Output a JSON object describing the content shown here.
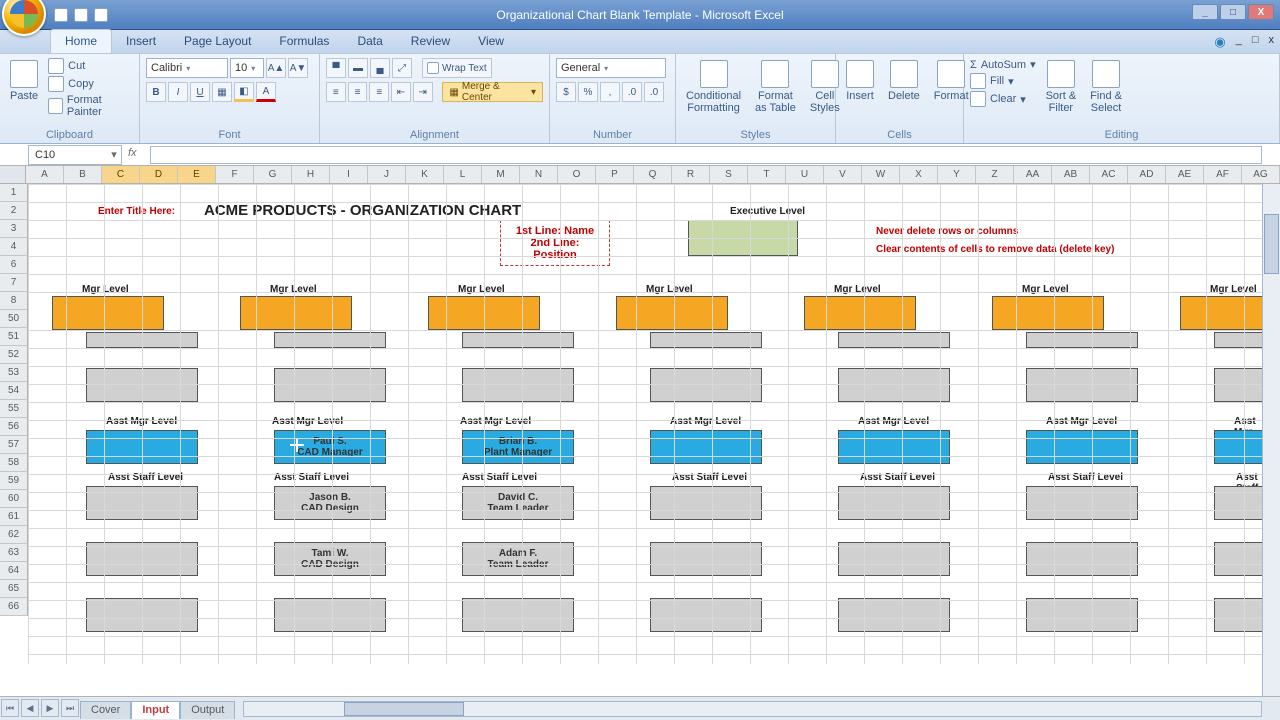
{
  "window": {
    "title": "Organizational Chart Blank Template - Microsoft Excel",
    "btn_min": "_",
    "btn_max": "□",
    "btn_close": "X"
  },
  "tabs": {
    "home": "Home",
    "insert": "Insert",
    "pagelayout": "Page Layout",
    "formulas": "Formulas",
    "data": "Data",
    "review": "Review",
    "view": "View"
  },
  "ribbon": {
    "clipboard": {
      "paste": "Paste",
      "cut": "Cut",
      "copy": "Copy",
      "fmtpainter": "Format Painter",
      "label": "Clipboard"
    },
    "font": {
      "family": "Calibri",
      "size": "10",
      "label": "Font"
    },
    "alignment": {
      "wrap": "Wrap Text",
      "merge": "Merge & Center",
      "label": "Alignment"
    },
    "number": {
      "format": "General",
      "label": "Number"
    },
    "styles": {
      "cf": "Conditional\nFormatting",
      "fat": "Format\nas Table",
      "cs": "Cell\nStyles",
      "label": "Styles"
    },
    "cells": {
      "insert": "Insert",
      "delete": "Delete",
      "format": "Format",
      "label": "Cells"
    },
    "editing": {
      "autosum": "AutoSum",
      "fill": "Fill",
      "clear": "Clear",
      "sort": "Sort &\nFilter",
      "find": "Find &\nSelect",
      "label": "Editing"
    }
  },
  "namebox": "C10",
  "cols": [
    "A",
    "B",
    "C",
    "D",
    "E",
    "F",
    "G",
    "H",
    "I",
    "J",
    "K",
    "L",
    "M",
    "N",
    "O",
    "P",
    "Q",
    "R",
    "S",
    "T",
    "U",
    "V",
    "W",
    "X",
    "Y",
    "Z",
    "AA",
    "AB",
    "AC",
    "AD",
    "AE",
    "AF",
    "AG"
  ],
  "selcols": [
    "C",
    "D",
    "E"
  ],
  "rows": [
    1,
    2,
    3,
    4,
    6,
    7,
    8,
    50,
    51,
    52,
    53,
    54,
    55,
    56,
    57,
    58,
    59,
    60,
    61,
    62,
    63,
    64,
    65,
    66
  ],
  "content": {
    "title_hint": "Enter Title Here:",
    "chart_title": "ACME PRODUCTS - ORGANIZATION CHART",
    "legend_l1": "1st Line: Name",
    "legend_l2": "2nd Line: Position",
    "exec_level": "Executive Level",
    "red1": "Never delete rows or columns",
    "red2": "Clear contents of cells to remove data (delete key)",
    "mgr_level": "Mgr Level",
    "asst_mgr": "Asst Mgr Level",
    "asst_staff": "Asst Staff Level",
    "col2": {
      "mgr_name": "Paul S.",
      "mgr_pos": "CAD Manager",
      "s1_name": "Jason B.",
      "s1_pos": "CAD Design",
      "s2_name": "Tami W.",
      "s2_pos": "CAD Design"
    },
    "col3": {
      "mgr_name": "Brian B.",
      "mgr_pos": "Plant Manager",
      "s1_name": "David C.",
      "s1_pos": "Team Leader",
      "s2_name": "Adam F.",
      "s2_pos": "Team Leader"
    }
  },
  "sheets": {
    "cover": "Cover",
    "input": "Input",
    "output": "Output"
  }
}
